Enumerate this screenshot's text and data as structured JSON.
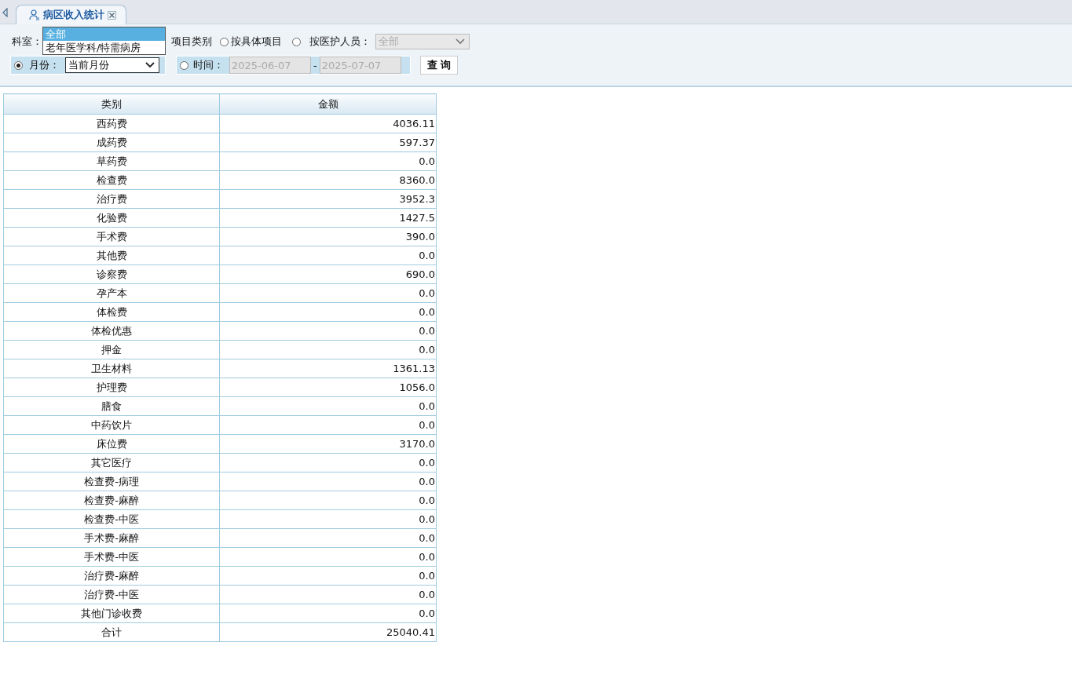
{
  "tab": {
    "label": "病区收入统计",
    "selected": true
  },
  "filters": {
    "dept_label": "科室：",
    "dept_dropdown": {
      "expanded": true,
      "options": [
        {
          "label": "全部",
          "selected": true
        },
        {
          "label": "老年医学科/特需病房",
          "selected": false
        }
      ]
    },
    "by_category_label": "项目类别",
    "by_item": {
      "label": "按具体项目",
      "selected": false
    },
    "by_staff": {
      "label": "按医护人员：",
      "selected": false,
      "select_value": "全部",
      "disabled": true
    },
    "by_month": {
      "label": "月份：",
      "selected": true,
      "select_value": "当前月份"
    },
    "by_time": {
      "label": "时间：",
      "selected": false,
      "from": "2025-06-07",
      "separator": "-",
      "to": "2025-07-07"
    },
    "query_button": "查 询"
  },
  "table": {
    "columns": [
      "类别",
      "金额"
    ],
    "rows": [
      {
        "category": "西药费",
        "amount": "4036.11"
      },
      {
        "category": "成药费",
        "amount": "597.37"
      },
      {
        "category": "草药费",
        "amount": "0.0"
      },
      {
        "category": "检查费",
        "amount": "8360.0"
      },
      {
        "category": "治疗费",
        "amount": "3952.3"
      },
      {
        "category": "化验费",
        "amount": "1427.5"
      },
      {
        "category": "手术费",
        "amount": "390.0"
      },
      {
        "category": "其他费",
        "amount": "0.0"
      },
      {
        "category": "诊察费",
        "amount": "690.0"
      },
      {
        "category": "孕产本",
        "amount": "0.0"
      },
      {
        "category": "体检费",
        "amount": "0.0"
      },
      {
        "category": "体检优惠",
        "amount": "0.0"
      },
      {
        "category": "押金",
        "amount": "0.0"
      },
      {
        "category": "卫生材料",
        "amount": "1361.13"
      },
      {
        "category": "护理费",
        "amount": "1056.0"
      },
      {
        "category": "膳食",
        "amount": "0.0"
      },
      {
        "category": "中药饮片",
        "amount": "0.0"
      },
      {
        "category": "床位费",
        "amount": "3170.0"
      },
      {
        "category": "其它医疗",
        "amount": "0.0"
      },
      {
        "category": "检查费-病理",
        "amount": "0.0"
      },
      {
        "category": "检查费-麻醉",
        "amount": "0.0"
      },
      {
        "category": "检查费-中医",
        "amount": "0.0"
      },
      {
        "category": "手术费-麻醉",
        "amount": "0.0"
      },
      {
        "category": "手术费-中医",
        "amount": "0.0"
      },
      {
        "category": "治疗费-麻醉",
        "amount": "0.0"
      },
      {
        "category": "治疗费-中医",
        "amount": "0.0"
      },
      {
        "category": "其他门诊收费",
        "amount": "0.0"
      },
      {
        "category": "合计",
        "amount": "25040.41"
      }
    ]
  }
}
